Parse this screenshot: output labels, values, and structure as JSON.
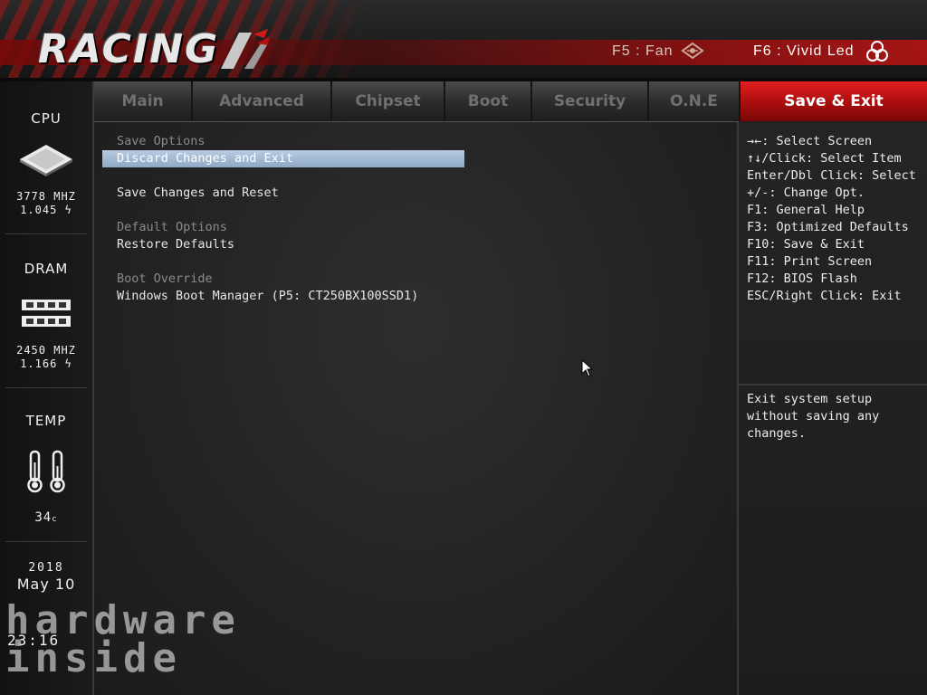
{
  "header": {
    "logo_text": "RACING",
    "fan_hotkey": "F5 : Fan",
    "led_hotkey": "F6 : Vivid Led"
  },
  "sidebar": {
    "cpu": {
      "title": "CPU",
      "freq": "3778 MHZ",
      "volt": "1.045",
      "icon": "cpu-chip-icon"
    },
    "dram": {
      "title": "DRAM",
      "freq": "2450 MHZ",
      "volt": "1.166",
      "icon": "memory-module-icon"
    },
    "temp": {
      "title": "TEMP",
      "value": "34",
      "icon": "thermometer-icon"
    },
    "date": {
      "year": "2018",
      "month_day": "May  10"
    },
    "time": "23:16"
  },
  "tabs": [
    {
      "label": "Main"
    },
    {
      "label": "Advanced"
    },
    {
      "label": "Chipset"
    },
    {
      "label": "Boot"
    },
    {
      "label": "Security"
    },
    {
      "label": "O.N.E"
    },
    {
      "label": "Save & Exit"
    }
  ],
  "main": {
    "save_options_header": "Save Options",
    "discard_changes_and_exit": "Discard Changes and Exit",
    "save_changes_and_reset": "Save Changes and Reset",
    "default_options_header": "Default Options",
    "restore_defaults": "Restore Defaults",
    "boot_override_header": "Boot Override",
    "windows_boot_manager": "Windows Boot Manager (P5: CT250BX100SSD1)"
  },
  "help": {
    "keys": [
      "→←: Select Screen",
      "↑↓/Click: Select Item",
      "Enter/Dbl Click: Select",
      "+/-: Change Opt.",
      "F1: General Help",
      "F3: Optimized Defaults",
      "F10: Save & Exit",
      "F11: Print Screen",
      "F12: BIOS Flash",
      "ESC/Right Click: Exit"
    ],
    "description": [
      "Exit system setup",
      "without saving any",
      "changes."
    ]
  },
  "watermark": {
    "line1": "hardware",
    "line2": "inside"
  },
  "colors": {
    "accent_red": "#c81414",
    "selection": "#9fb6d2",
    "text": "#e6e6e6",
    "muted": "#8a8a8a"
  }
}
